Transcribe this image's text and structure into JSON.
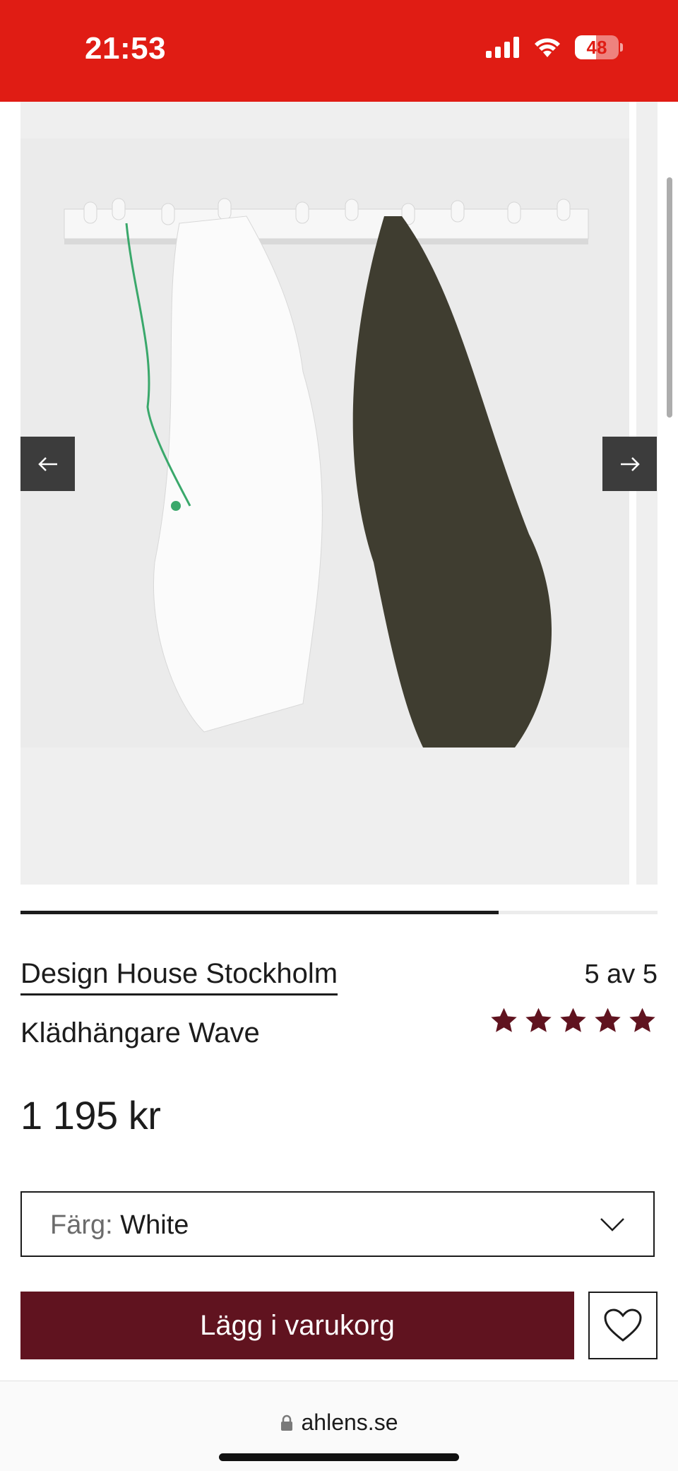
{
  "status_bar": {
    "time": "21:53",
    "battery_level": "48",
    "battery_fraction": 0.48
  },
  "gallery": {
    "image_alt": "Klädhängare Wave",
    "progress": 0.75,
    "prev_icon": "arrow-left-icon",
    "next_icon": "arrow-right-icon"
  },
  "product": {
    "brand": "Design House Stockholm",
    "name": "Klädhängare Wave",
    "rating_text": "5 av 5",
    "rating_value": 5,
    "rating_max": 5,
    "price": "1 195 kr"
  },
  "color_select": {
    "label": "Färg:",
    "value": "White"
  },
  "actions": {
    "add_to_cart": "Lägg i varukorg",
    "wishlist_icon": "heart-icon"
  },
  "browser": {
    "url": "ahlens.se"
  },
  "colors": {
    "status_bar": "#e01c14",
    "accent": "#60131f",
    "star": "#60131f"
  }
}
